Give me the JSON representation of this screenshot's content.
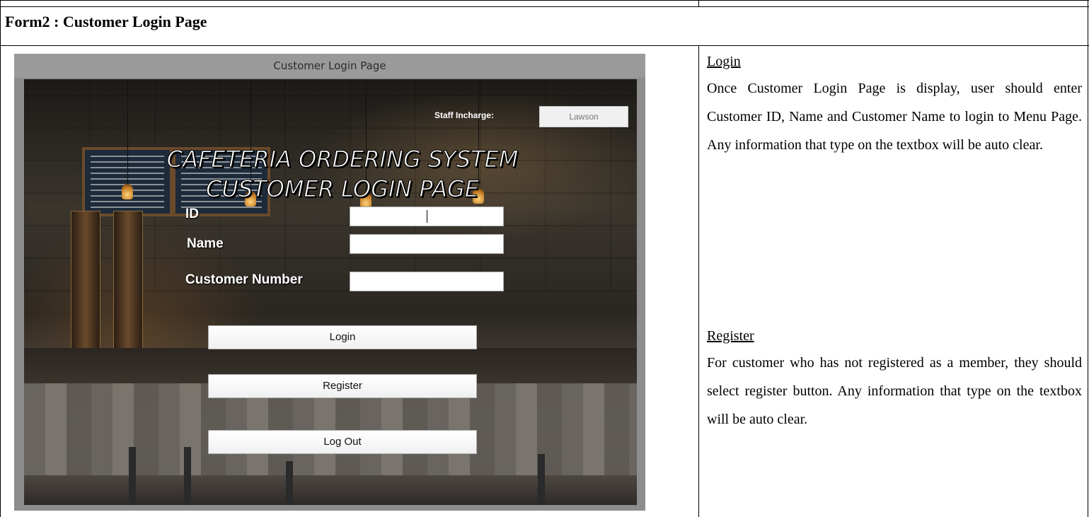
{
  "section": {
    "title": "Form2 : Customer Login Page"
  },
  "form": {
    "window_title": "Customer Login Page",
    "staff_label": "Staff Incharge:",
    "staff_value": "Lawson",
    "headline_line1": "CAFETERIA ORDERING SYSTEM",
    "headline_line2": "CUSTOMER LOGIN PAGE",
    "fields": [
      {
        "label": "ID",
        "value": ""
      },
      {
        "label": "Name",
        "value": ""
      },
      {
        "label": "Customer Number",
        "value": ""
      }
    ],
    "buttons": {
      "login": "Login",
      "register": "Register",
      "logout": "Log Out"
    }
  },
  "description": {
    "login_heading": "Login",
    "login_text": "Once Customer Login Page is display, user should enter Customer ID, Name and Customer Name to login to Menu Page. Any information that type on the textbox will be auto clear.",
    "register_heading": "Register",
    "register_text": "For customer who has not registered as a member, they should select register button. Any information that type on the textbox will be auto clear."
  }
}
